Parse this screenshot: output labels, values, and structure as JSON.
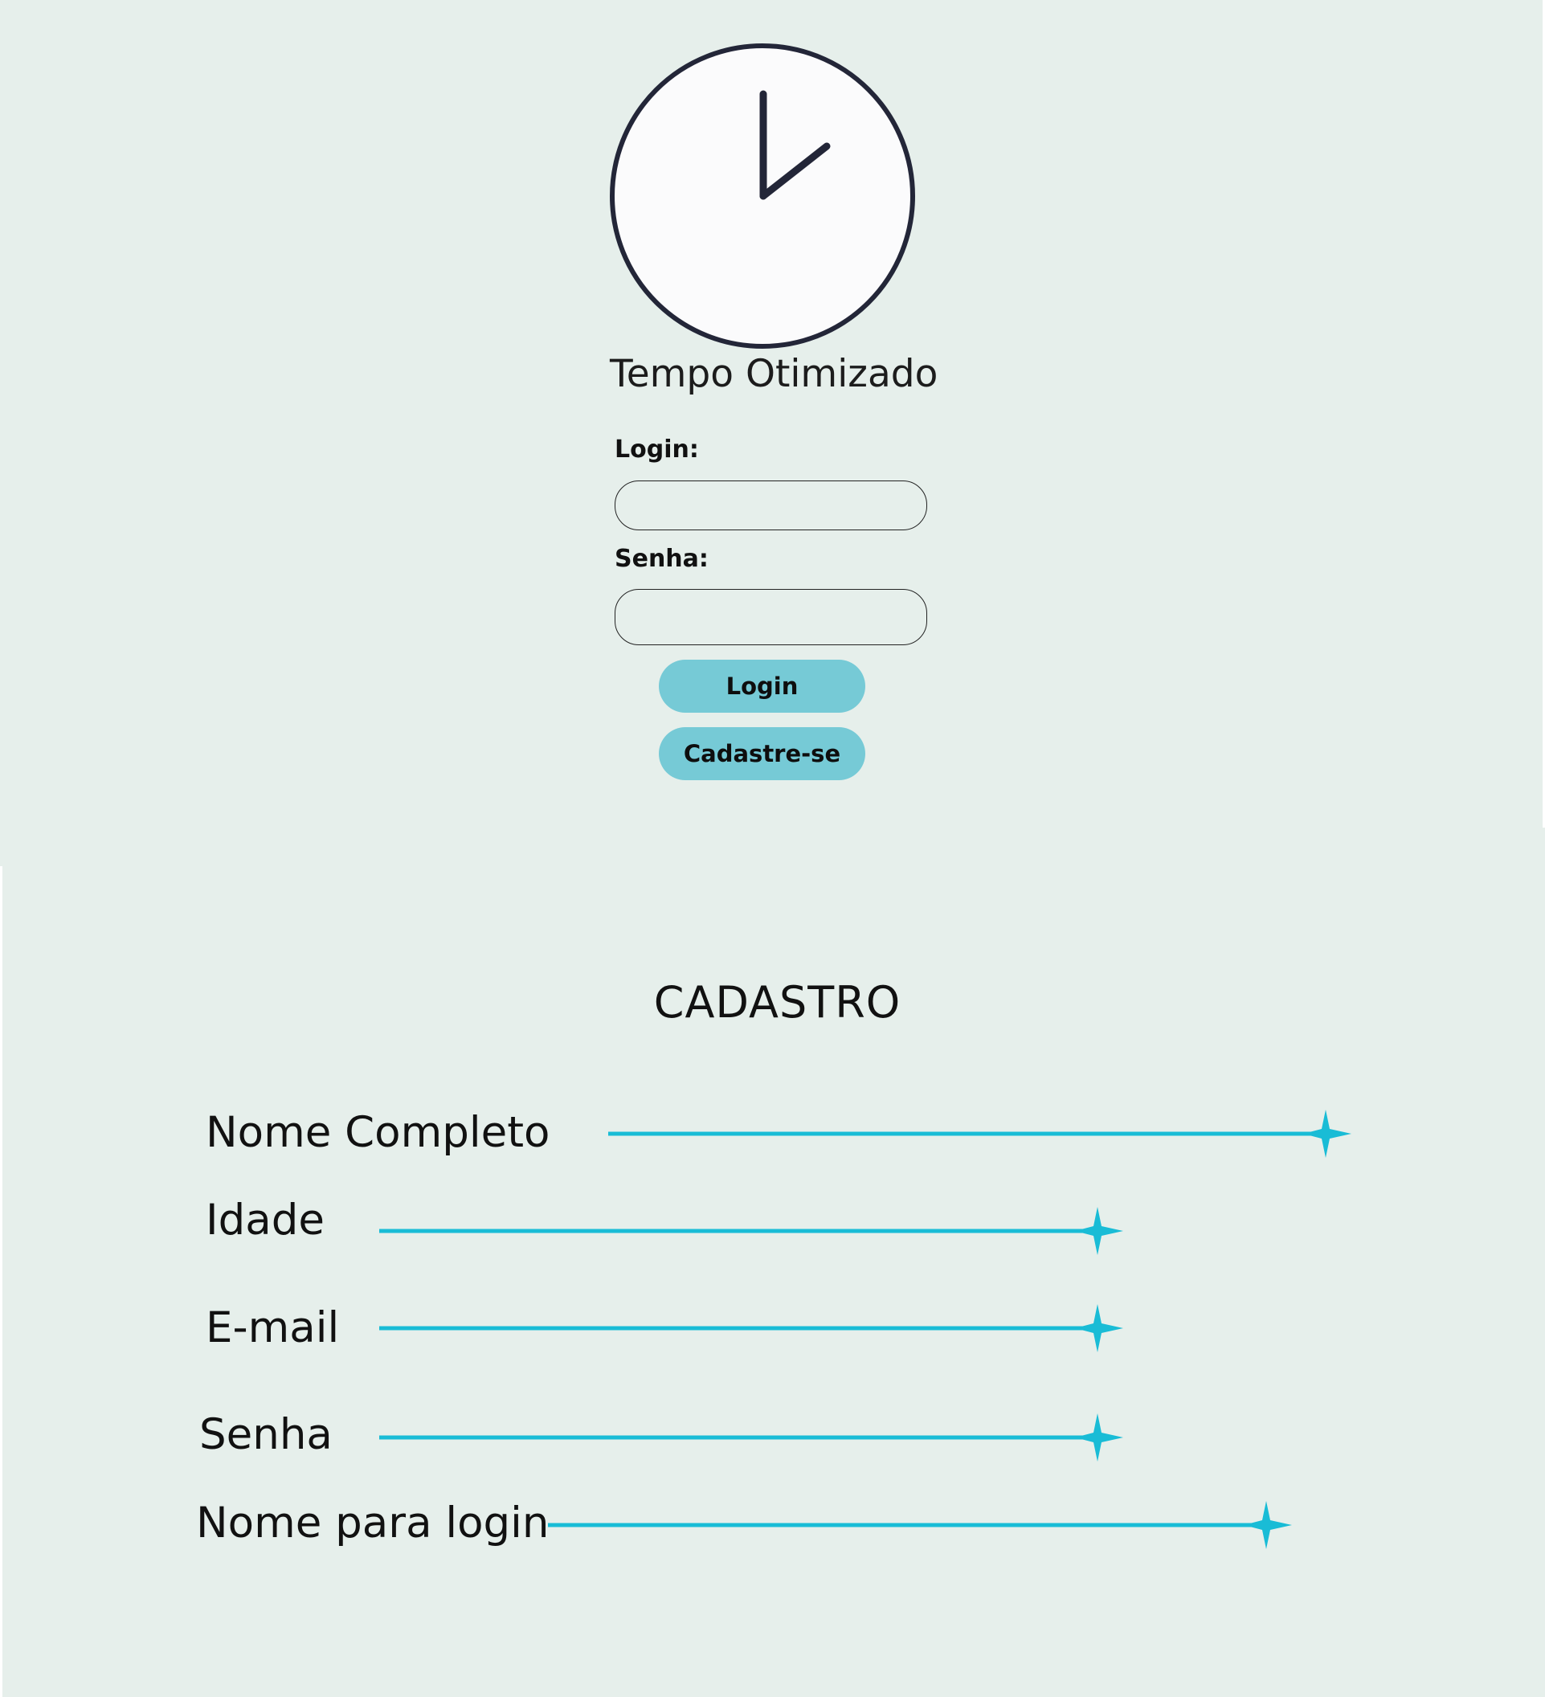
{
  "login": {
    "app_title": "Tempo Otimizado",
    "login_label": "Login:",
    "senha_label": "Senha:",
    "login_value": "",
    "senha_value": "",
    "login_button": "Login",
    "cadastre_button": "Cadastre-se",
    "clock_icon": "clock-icon"
  },
  "cadastro": {
    "title": "CADASTRO",
    "fields": [
      {
        "label": "Nome Completo"
      },
      {
        "label": "Idade"
      },
      {
        "label": "E-mail"
      },
      {
        "label": "Senha"
      },
      {
        "label": "Nome para login"
      }
    ],
    "star_icon": "sparkle-star-icon"
  },
  "colors": {
    "background": "#e6efeb",
    "button": "#76cad6",
    "line_accent": "#19bcd6",
    "clock_stroke": "#232638"
  }
}
